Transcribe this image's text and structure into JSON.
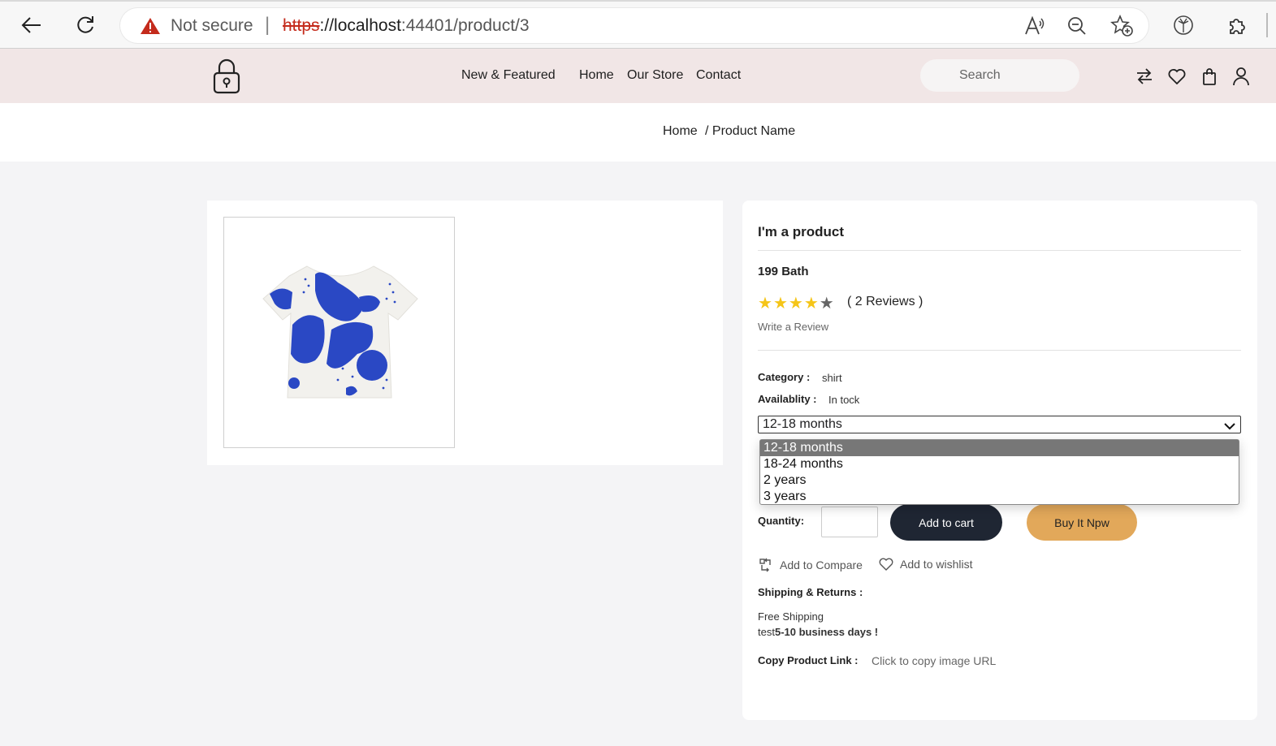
{
  "browser": {
    "security_label": "Not secure",
    "url_scheme": "https",
    "url_host": "://localhost",
    "url_rest": ":44401/product/3"
  },
  "header": {
    "nav": [
      "New & Featured",
      "Home",
      "Our Store",
      "Contact"
    ],
    "search_placeholder": "Search"
  },
  "breadcrumb": {
    "home": "Home",
    "current": "/ Product Name"
  },
  "product": {
    "title": "I'm a product",
    "price": "199 Bath",
    "rating": 4,
    "rating_max": 5,
    "reviews_label": "( 2 Reviews )",
    "write_review": "Write a Review",
    "category_label": "Category :",
    "category_value": "shirt",
    "availability_label": "Availablity :",
    "availability_value": "In tock",
    "size_selected": "12-18 months",
    "size_options": [
      "12-18 months",
      "18-24 months",
      "2 years",
      "3 years"
    ],
    "quantity_label": "Quantity:",
    "add_to_cart": "Add to cart",
    "buy_now": "Buy It Npw",
    "add_to_compare": "Add to Compare",
    "add_to_wishlist": "Add to wishlist",
    "shipping_label": "Shipping & Returns :",
    "shipping_line1": "Free Shipping",
    "shipping_line2_prefix": "test",
    "shipping_line2_bold": "5-10 business days !",
    "copy_label": "Copy Product Link :",
    "copy_value": "Click to copy image URL"
  },
  "colors": {
    "header_bg": "#f1e6e6",
    "cart_button": "#1f2633",
    "buy_button": "#e2a85a",
    "star": "#f5c518",
    "shirt_pattern": "#2a48c4"
  }
}
